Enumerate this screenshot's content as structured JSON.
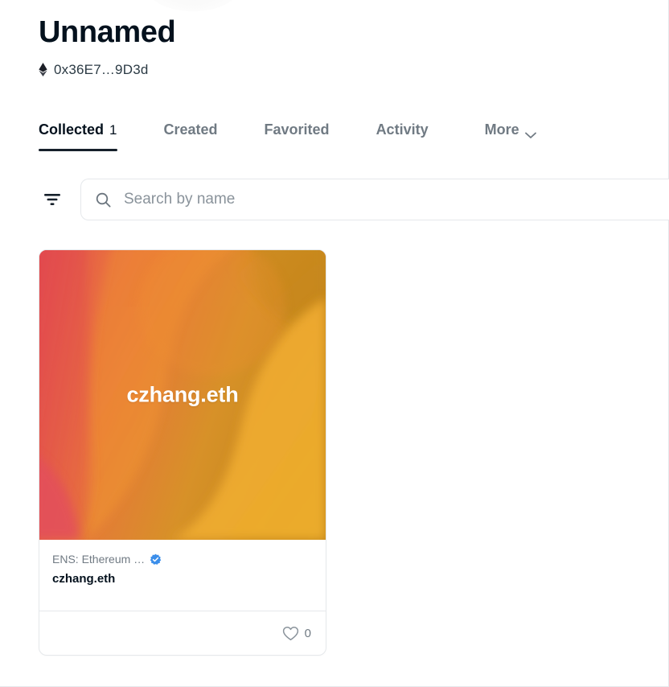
{
  "profile": {
    "title": "Unnamed",
    "chain_icon": "ethereum-icon",
    "address": "0x36E7…9D3d"
  },
  "tabs": [
    {
      "label": "Collected",
      "count": "1",
      "active": true
    },
    {
      "label": "Created",
      "count": "",
      "active": false
    },
    {
      "label": "Favorited",
      "count": "",
      "active": false
    },
    {
      "label": "Activity",
      "count": "",
      "active": false
    }
  ],
  "more_tab": {
    "label": "More",
    "icon": "chevron-down-icon"
  },
  "toolbar": {
    "filter_icon": "filter-icon",
    "search_icon": "search-icon",
    "search_placeholder": "Search by name",
    "search_value": ""
  },
  "cards": [
    {
      "media_label": "czhang.eth",
      "collection": "ENS: Ethereum …",
      "verified": true,
      "verified_icon": "verified-badge-icon",
      "name": "czhang.eth",
      "favorite_icon": "heart-icon",
      "favorite_count": "0"
    }
  ],
  "colors": {
    "text_primary": "#04111D",
    "text_muted": "#707A83",
    "border": "#E5E8EB",
    "verified_blue": "#3B8EEA",
    "gradient_red": "#E34F5C",
    "gradient_coral": "#E05A40",
    "gradient_orange": "#F07A3A",
    "gradient_amber": "#EFA62E",
    "gradient_gold": "#C8891E"
  }
}
